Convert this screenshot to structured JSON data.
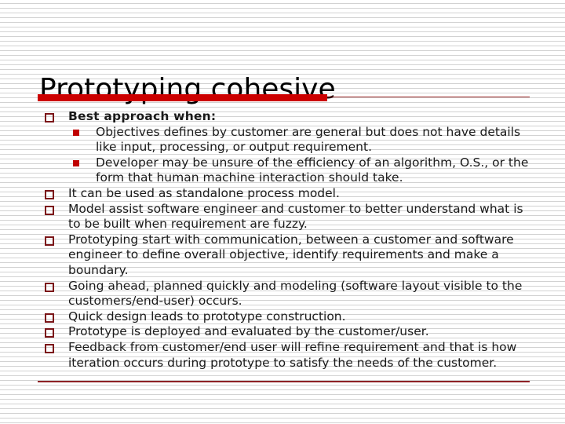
{
  "slide": {
    "title": "Prototyping cohesive",
    "colors": {
      "title_bar_thick": "#cc0000",
      "title_bar_thin": "#9e2a2a",
      "footer_rule": "#8e2226",
      "marker_level1": "#7b1518",
      "marker_level2": "#c00000",
      "text": "#1a1a1a",
      "title_text": "#000000"
    },
    "bullets": [
      {
        "level": 1,
        "bold": true,
        "text": "Best approach when:",
        "marker": "hollow-square-bullet-icon"
      },
      {
        "level": 2,
        "bold": false,
        "text": "Objectives defines by customer are general but does not have details like input, processing, or output requirement.",
        "marker": "filled-square-bullet-icon"
      },
      {
        "level": 2,
        "bold": false,
        "text": "Developer may be unsure of the efficiency of an algorithm, O.S., or the form that human machine interaction should take.",
        "marker": "filled-square-bullet-icon"
      },
      {
        "level": 1,
        "bold": false,
        "text": "It can be used as standalone process model.",
        "marker": "hollow-square-bullet-icon"
      },
      {
        "level": 1,
        "bold": false,
        "text": "Model assist software engineer and customer to better understand what is to be built when requirement are fuzzy.",
        "marker": "hollow-square-bullet-icon"
      },
      {
        "level": 1,
        "bold": false,
        "text": "Prototyping start with communication, between a customer and software engineer to define overall objective, identify requirements and make a boundary.",
        "marker": "hollow-square-bullet-icon"
      },
      {
        "level": 1,
        "bold": false,
        "text": "Going ahead, planned quickly and modeling (software layout visible to the customers/end-user) occurs.",
        "marker": "hollow-square-bullet-icon"
      },
      {
        "level": 1,
        "bold": false,
        "text": "Quick design leads to prototype construction.",
        "marker": "hollow-square-bullet-icon"
      },
      {
        "level": 1,
        "bold": false,
        "text": "Prototype is deployed and evaluated by the customer/user.",
        "marker": "hollow-square-bullet-icon"
      },
      {
        "level": 1,
        "bold": false,
        "text": "Feedback from customer/end user will refine requirement and that is how iteration occurs during prototype to satisfy the needs of the customer.",
        "marker": "hollow-square-bullet-icon"
      }
    ]
  }
}
